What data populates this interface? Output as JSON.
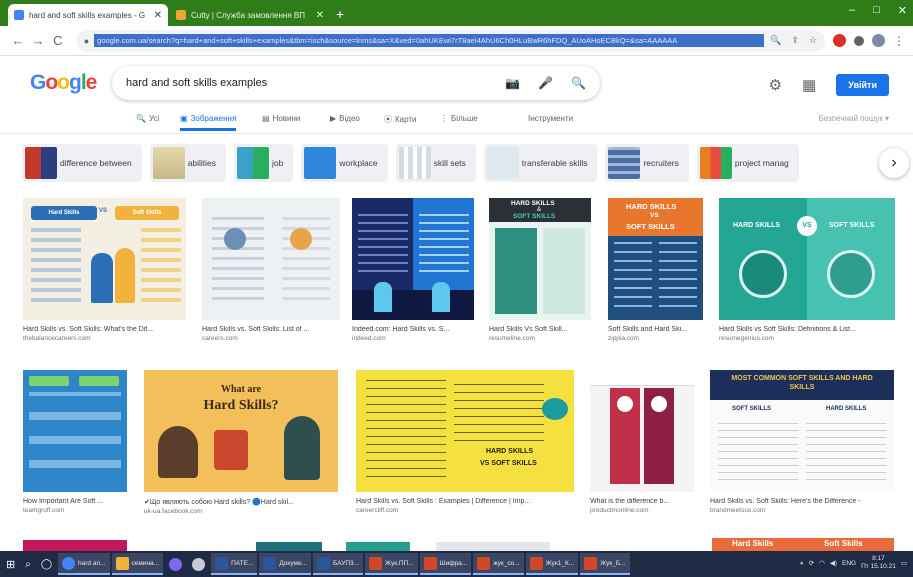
{
  "browser": {
    "tabs": [
      {
        "label": "hard and soft skills examples - G",
        "active": true,
        "icon_color": "#4285f4"
      },
      {
        "label": "Cutty | Служба замовлення ВП",
        "active": false,
        "icon_color": "#f2a33a"
      }
    ],
    "new_tab": "+",
    "window_controls": [
      "–",
      "□",
      "✕"
    ],
    "url": "google.com.ua/search?q=hard+and+soft+skills+examples&tbm=isch&source=lnms&sa=X&ved=0ahUKEwi7rT8aeI4AhU6Ch0HLuBwR6hFDQ_AUoAHoECBkQ=&sa=AAAAAA",
    "nav": {
      "back": "←",
      "forward": "→",
      "reload": "C"
    }
  },
  "google": {
    "logo_letters": [
      {
        "ch": "G",
        "color": "#4285f4"
      },
      {
        "ch": "o",
        "color": "#ea4335"
      },
      {
        "ch": "o",
        "color": "#fbbc05"
      },
      {
        "ch": "g",
        "color": "#4285f4"
      },
      {
        "ch": "l",
        "color": "#34a853"
      },
      {
        "ch": "e",
        "color": "#ea4335"
      }
    ],
    "query": "hard and soft skills examples",
    "signin_label": "Увійти",
    "filters": {
      "all": "Усі",
      "images": "Зображення",
      "news": "Новини",
      "video": "Відео",
      "maps": "Карти",
      "more": "Більше",
      "tools": "Інструменти",
      "safesearch": "Безпечний пошук ▾"
    },
    "chips": [
      {
        "label": "difference between",
        "thumb": "#c0392b"
      },
      {
        "label": "abilities",
        "thumb": "#e8d9a8"
      },
      {
        "label": "job",
        "thumb": "#3aa1c9"
      },
      {
        "label": "workplace",
        "thumb": "#2e86de"
      },
      {
        "label": "skill sets",
        "thumb": "#d5dbe1"
      },
      {
        "label": "transferable skills",
        "thumb": "#dfe8ee"
      },
      {
        "label": "recruiters",
        "thumb": "#4a6fa5"
      },
      {
        "label": "project manag",
        "thumb": "#e67e22"
      }
    ],
    "chip_next": "›",
    "results": [
      {
        "title": "Hard Skills vs. Soft Skills: What's the Dif...",
        "source": "thebalancecareers.com"
      },
      {
        "title": "Hard Skills vs. Soft Skills: List of ...",
        "source": "careers.com"
      },
      {
        "title": "Indeed.com: Hard Skills vs. S...",
        "source": "indeed.com"
      },
      {
        "title": "Hard Skills Vs Soft Skill...",
        "source": "resumeline.com"
      },
      {
        "title": "Soft Skills and Hard Ski...",
        "source": "zippia.com"
      },
      {
        "title": "Hard Skills vs Soft Skills: Definitions & List...",
        "source": "resumegenius.com"
      },
      {
        "title": "How Important Are Soft ...",
        "source": "teamgroff.com"
      },
      {
        "title": "✔Що являють собою Hard skills? 🔵Hard skil...",
        "source": "uk-ua.facebook.com"
      },
      {
        "title": "Hard Skills vs. Soft Skills : Examples | Difference | Imp...",
        "source": "careercliff.com"
      },
      {
        "title": "What is the difference b...",
        "source": "productmonline.com"
      },
      {
        "title": "Hard Skills vs. Soft Skills: Here's the Difference -",
        "source": "brandmeetsus.com"
      }
    ],
    "image_texts": {
      "r1a_hard": "Hard Skills",
      "r1a_vs": "VS",
      "r1a_soft": "Soft Skills",
      "r1d_hard": "HARD SKILLS",
      "r1d_vs": "&",
      "r1d_soft": "SOFT SKILLS",
      "r1e_hard": "HARD SKILLS",
      "r1e_vs": "VS",
      "r1e_soft": "SOFT SKILLS",
      "r1f_hard": "HARD SKILLS",
      "r1f_vs": "VS",
      "r1f_soft": "SOFT SKILLS",
      "r2b_title1": "What are",
      "r2b_title2": "Hard Skills?",
      "r2c_a": "HARD SKILLS",
      "r2c_b": "VS SOFT SKILLS",
      "r2e_title": "MOST COMMON SOFT SKILLS AND HARD SKILLS",
      "r2e_c1": "SOFT SKILLS",
      "r2e_c2": "HARD SKILLS",
      "r3_hard": "Hard Skills",
      "r3_soft": "Soft Skills"
    }
  },
  "taskbar": {
    "items": [
      {
        "label": "hard an...",
        "color": "#4285f4",
        "open": true
      },
      {
        "label": "семина...",
        "color": "#f2b33d",
        "open": true
      },
      {
        "label": "",
        "color": "#7b68ee",
        "open": false
      },
      {
        "label": "",
        "color": "#c6cbd4",
        "open": false
      },
      {
        "label": "ПАТЕ...",
        "color": "#2b579a",
        "open": true
      },
      {
        "label": "Докуме...",
        "color": "#2b579a",
        "open": true
      },
      {
        "label": "БАУП3...",
        "color": "#2b579a",
        "open": true
      },
      {
        "label": "Жук.ПП...",
        "color": "#d24726",
        "open": true
      },
      {
        "label": "Шифра...",
        "color": "#d24726",
        "open": true
      },
      {
        "label": "жук_со...",
        "color": "#d24726",
        "open": true
      },
      {
        "label": "Жук1_К...",
        "color": "#d24726",
        "open": true
      },
      {
        "label": "Жук_Б...",
        "color": "#d24726",
        "open": true
      }
    ],
    "lang": "ENG",
    "time": "8:17",
    "date": "Пт 15.10.21"
  }
}
